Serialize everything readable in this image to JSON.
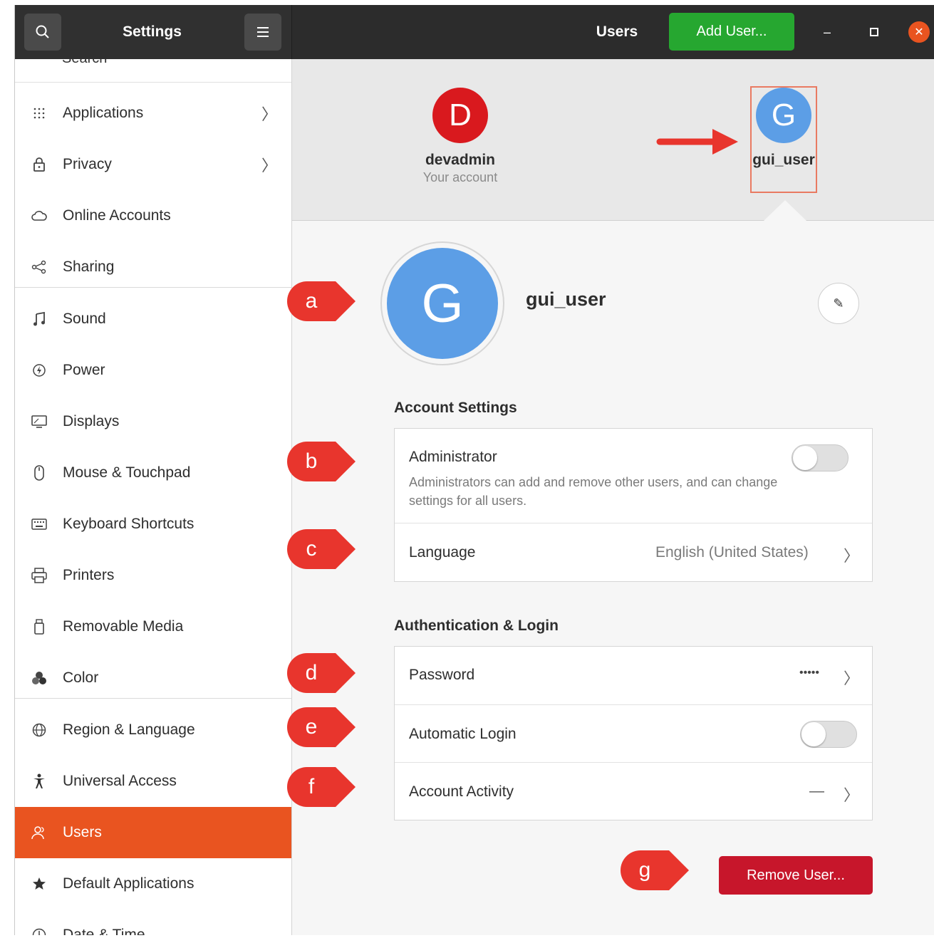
{
  "window": {
    "app_title": "Settings",
    "page_title": "Users",
    "add_user_label": "Add User...",
    "minimize": "–",
    "maximize": "▫",
    "close": "✕"
  },
  "sidebar": {
    "search_remnant": "Search",
    "items": [
      {
        "label": "Applications",
        "icon": "grid-icon",
        "has_chevron": true
      },
      {
        "label": "Privacy",
        "icon": "lock-icon",
        "has_chevron": true
      },
      {
        "label": "Online Accounts",
        "icon": "cloud-icon"
      },
      {
        "label": "Sharing",
        "icon": "share-icon"
      },
      {
        "label": "Sound",
        "icon": "music-note-icon"
      },
      {
        "label": "Power",
        "icon": "power-icon"
      },
      {
        "label": "Displays",
        "icon": "display-icon"
      },
      {
        "label": "Mouse & Touchpad",
        "icon": "mouse-icon"
      },
      {
        "label": "Keyboard Shortcuts",
        "icon": "keyboard-icon"
      },
      {
        "label": "Printers",
        "icon": "printer-icon"
      },
      {
        "label": "Removable Media",
        "icon": "removable-media-icon"
      },
      {
        "label": "Color",
        "icon": "color-icon"
      },
      {
        "label": "Region & Language",
        "icon": "globe-icon"
      },
      {
        "label": "Universal Access",
        "icon": "accessibility-icon"
      },
      {
        "label": "Users",
        "icon": "users-icon",
        "active": true
      },
      {
        "label": "Default Applications",
        "icon": "star-icon"
      },
      {
        "label": "Date & Time",
        "icon": "clock-icon"
      }
    ],
    "chevron": "〉"
  },
  "users_carousel": {
    "users": [
      {
        "initial": "D",
        "name": "devadmin",
        "subtitle": "Your account",
        "color": "#d9191e"
      },
      {
        "initial": "G",
        "name": "gui_user",
        "color": "#5c9ee6",
        "selected": true
      }
    ]
  },
  "user_detail": {
    "initial": "G",
    "name": "gui_user",
    "avatar_color": "#5c9ee6",
    "edit_icon": "✎"
  },
  "account_settings": {
    "title": "Account Settings",
    "administrator": {
      "label": "Administrator",
      "description": "Administrators can add and remove other users, and can change settings for all users.",
      "enabled": false
    },
    "language": {
      "label": "Language",
      "value": "English (United States)"
    }
  },
  "authentication": {
    "title": "Authentication & Login",
    "password": {
      "label": "Password",
      "value": "•••••"
    },
    "automatic_login": {
      "label": "Automatic Login",
      "enabled": false
    },
    "account_activity": {
      "label": "Account Activity",
      "value": "—"
    }
  },
  "remove_user_label": "Remove User...",
  "callouts": [
    "a",
    "b",
    "c",
    "d",
    "e",
    "f",
    "g"
  ],
  "colors": {
    "accent": "#e95420",
    "add_button": "#26a730",
    "remove_button": "#c7162b",
    "callout": "#e8352d",
    "highlight_border": "#e97a62"
  }
}
